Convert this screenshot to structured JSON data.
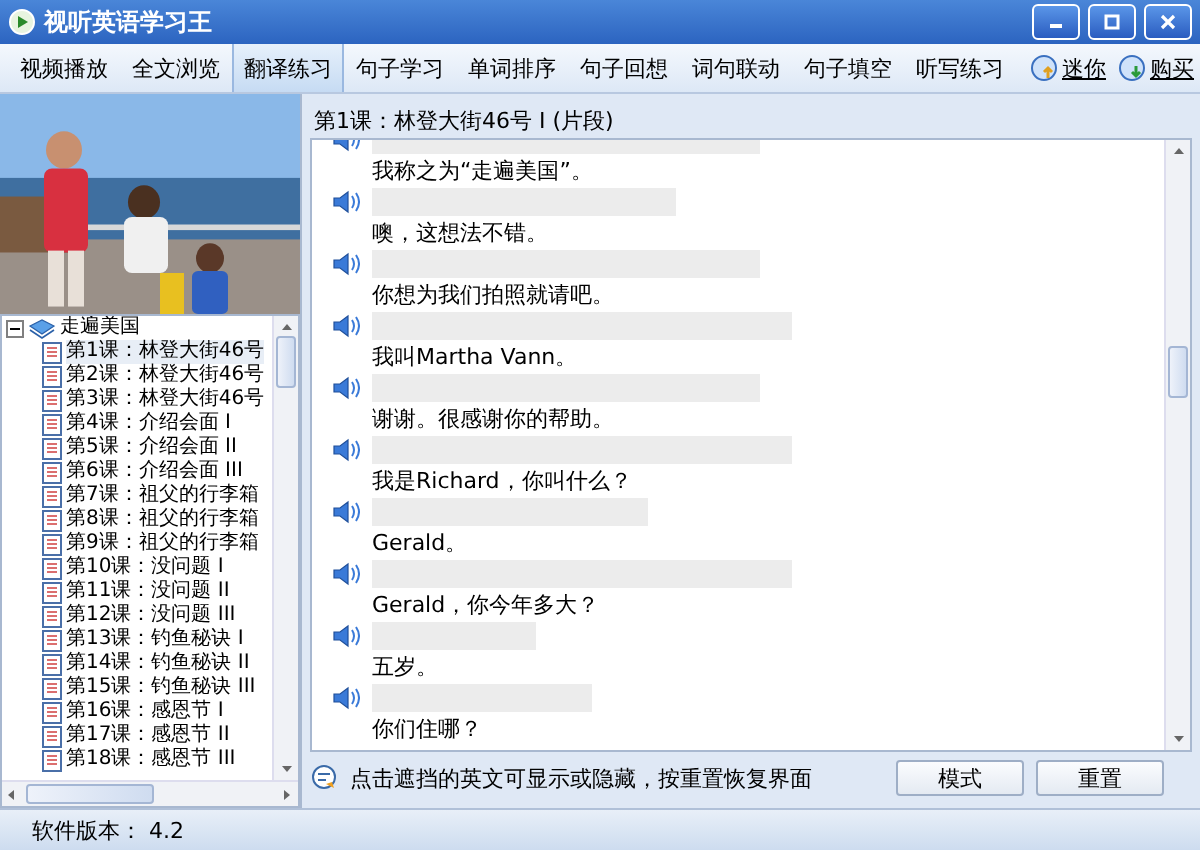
{
  "window": {
    "title": "视听英语学习王"
  },
  "tabs": [
    {
      "label": "视频播放",
      "selected": false
    },
    {
      "label": "全文浏览",
      "selected": false
    },
    {
      "label": "翻译练习",
      "selected": true
    },
    {
      "label": "句子学习",
      "selected": false
    },
    {
      "label": "单词排序",
      "selected": false
    },
    {
      "label": "句子回想",
      "selected": false
    },
    {
      "label": "词句联动",
      "selected": false
    },
    {
      "label": "句子填空",
      "selected": false
    },
    {
      "label": "听写练习",
      "selected": false
    }
  ],
  "links": [
    {
      "label": "迷你",
      "kind": "mini"
    },
    {
      "label": "购买",
      "kind": "buy"
    }
  ],
  "tree": {
    "label": "走遍美国",
    "expanded": true,
    "children": [
      {
        "label": "第1课：林登大街46号",
        "selected": true
      },
      {
        "label": "第2课：林登大街46号",
        "selected": false
      },
      {
        "label": "第3课：林登大街46号",
        "selected": false
      },
      {
        "label": "第4课：介绍会面 I",
        "selected": false
      },
      {
        "label": "第5课：介绍会面 II",
        "selected": false
      },
      {
        "label": "第6课：介绍会面 III",
        "selected": false
      },
      {
        "label": "第7课：祖父的行李箱",
        "selected": false
      },
      {
        "label": "第8课：祖父的行李箱",
        "selected": false
      },
      {
        "label": "第9课：祖父的行李箱",
        "selected": false
      },
      {
        "label": "第10课：没问题 I",
        "selected": false
      },
      {
        "label": "第11课：没问题 II",
        "selected": false
      },
      {
        "label": "第12课：没问题 III",
        "selected": false
      },
      {
        "label": "第13课：钓鱼秘诀 I",
        "selected": false
      },
      {
        "label": "第14课：钓鱼秘诀 II",
        "selected": false
      },
      {
        "label": "第15课：钓鱼秘诀 III",
        "selected": false
      },
      {
        "label": "第16课：感恩节 I",
        "selected": false
      },
      {
        "label": "第17课：感恩节 II",
        "selected": false
      },
      {
        "label": "第18课：感恩节 III",
        "selected": false
      }
    ]
  },
  "lesson_title": "第1课：林登大街46号 I (片段)",
  "sentences": [
    {
      "translation": "我称之为“走遍美国”。"
    },
    {
      "translation": "噢，这想法不错。"
    },
    {
      "translation": "你想为我们拍照就请吧。"
    },
    {
      "translation": "我叫Martha Vann。"
    },
    {
      "translation": "谢谢。很感谢你的帮助。"
    },
    {
      "translation": "我是Richard，你叫什么？"
    },
    {
      "translation": "Gerald。"
    },
    {
      "translation": "Gerald，你今年多大？"
    },
    {
      "translation": "五岁。"
    },
    {
      "translation": "你们住哪？"
    }
  ],
  "hint": "点击遮挡的英文可显示或隐藏，按重置恢复界面",
  "buttons": [
    "模式",
    "重置"
  ],
  "status_bar": "软件版本： 4.2"
}
